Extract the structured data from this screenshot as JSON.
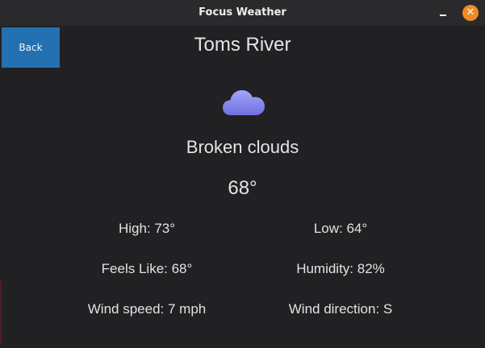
{
  "window": {
    "title": "Focus Weather",
    "close_glyph": "✕"
  },
  "nav": {
    "back_label": "Back"
  },
  "weather": {
    "city": "Toms River",
    "icon": "cloud-icon",
    "condition": "Broken clouds",
    "temperature": "68°",
    "high": "High: 73°",
    "low": "Low: 64°",
    "feels_like": "Feels Like: 68°",
    "humidity": "Humidity: 82%",
    "wind_speed": "Wind speed: 7 mph",
    "wind_direction": "Wind direction: S"
  },
  "colors": {
    "background": "#212123",
    "titlebar": "#2a2a2c",
    "accent_button": "#2471b1",
    "close_button": "#f08a24",
    "cloud": "#8a8cf0"
  }
}
